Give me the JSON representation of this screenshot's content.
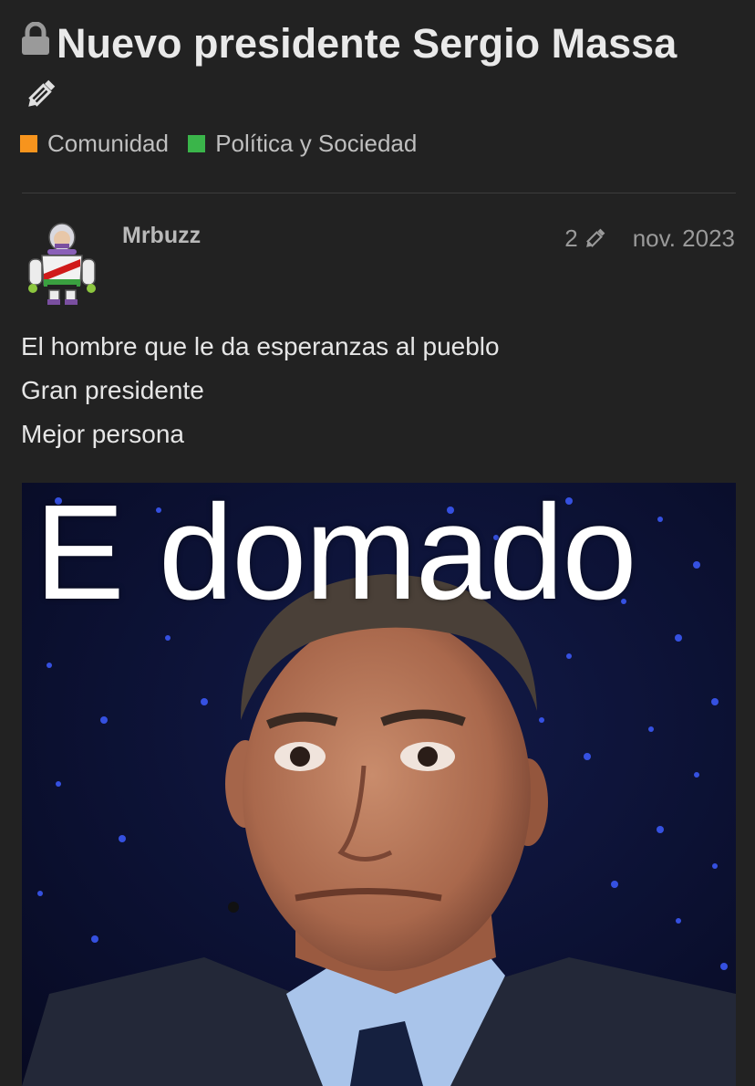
{
  "topic": {
    "title": "Nuevo presidente Sergio Massa",
    "lock_icon": "lock-icon",
    "edit_icon": "pencil-icon"
  },
  "categories": [
    {
      "label": "Comunidad",
      "color": "#F7941D"
    },
    {
      "label": "Política y Sociedad",
      "color": "#3AB54A"
    }
  ],
  "post": {
    "username": "Mrbuzz",
    "edit_count": "2",
    "date": "nov. 2023",
    "lines": [
      "El hombre que le da esperanzas al pueblo",
      "Gran presidente",
      "Mejor persona"
    ],
    "meme_caption": "E domado"
  }
}
